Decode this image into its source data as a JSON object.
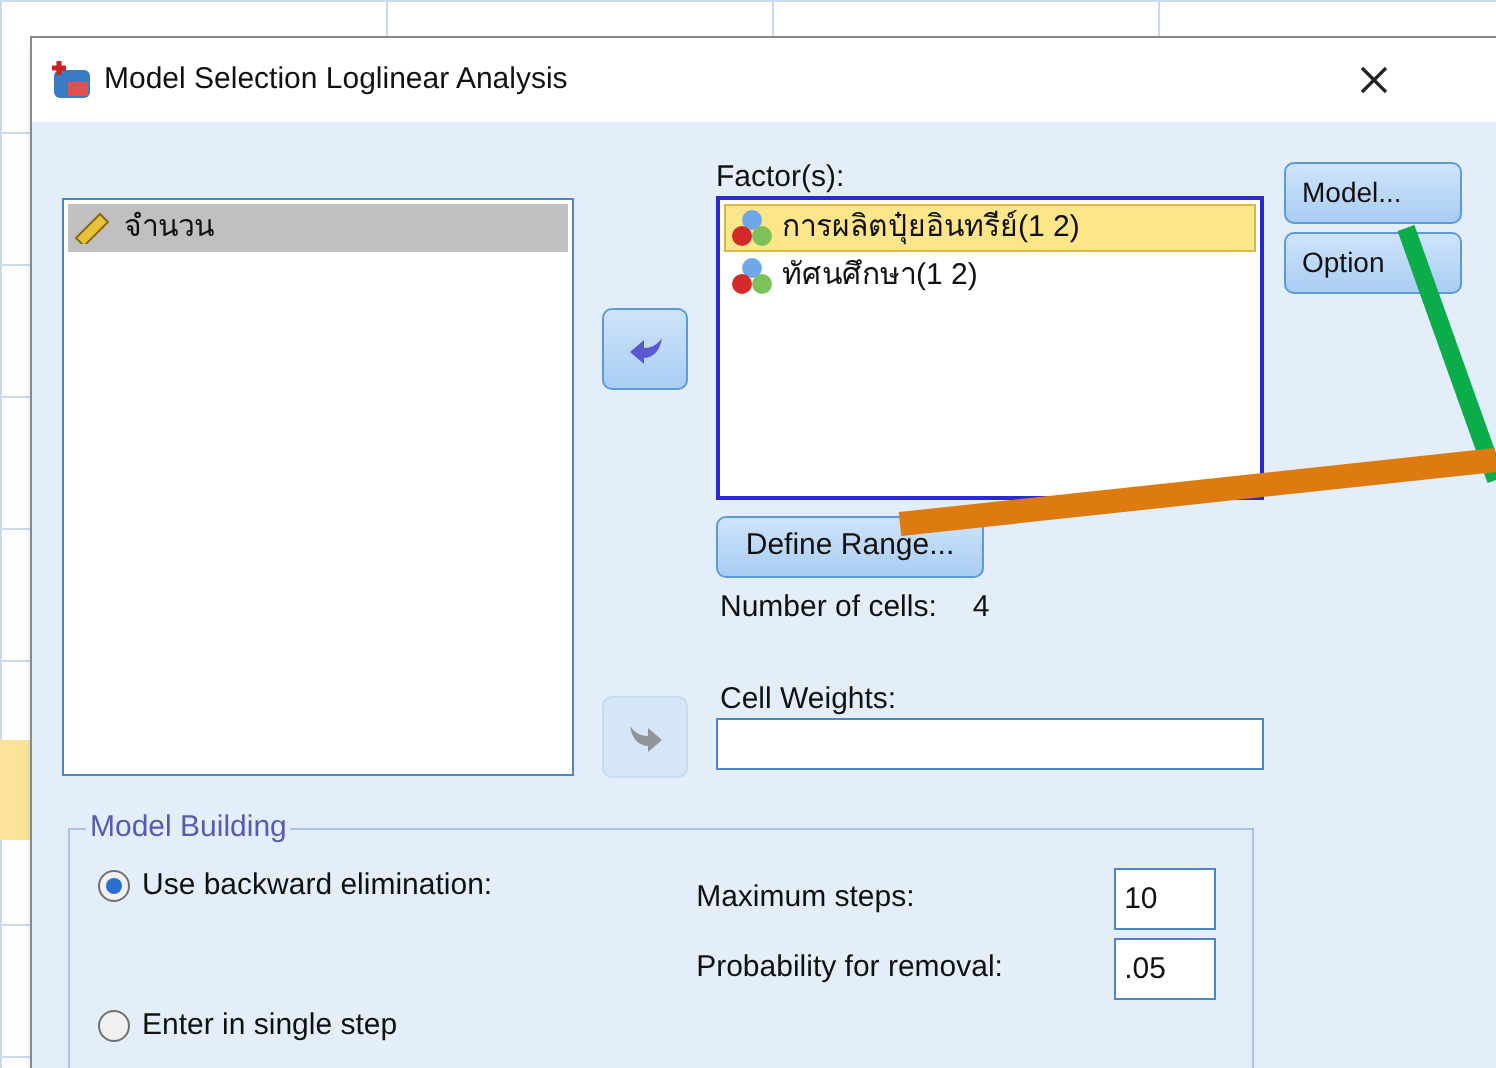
{
  "window": {
    "title": "Model Selection Loglinear Analysis"
  },
  "variables": [
    {
      "label": "จำนวน",
      "selected": true
    }
  ],
  "move_buttons": [
    {
      "kind": "left",
      "disabled": false
    },
    {
      "kind": "right",
      "disabled": true
    }
  ],
  "factors": {
    "label": "Factor(s):",
    "items": [
      {
        "label": "การผลิตปุ๋ยอินทรีย์(1 2)",
        "selected": true
      },
      {
        "label": "ทัศนศึกษา(1 2)",
        "selected": false
      }
    ]
  },
  "define_range_button": "Define Range...",
  "number_of_cells": {
    "label": "Number of cells:",
    "value": "4"
  },
  "cell_weights": {
    "label": "Cell Weights:"
  },
  "side_buttons": [
    "Model...",
    "Option"
  ],
  "model_building": {
    "title": "Model Building",
    "options": [
      {
        "label": "Use backward elimination:",
        "selected": true
      },
      {
        "label": "Enter in single step",
        "selected": false
      }
    ],
    "fields": [
      {
        "label": "Maximum steps:",
        "value": "10"
      },
      {
        "label": "Probability for removal:",
        "value": ".05"
      }
    ]
  }
}
